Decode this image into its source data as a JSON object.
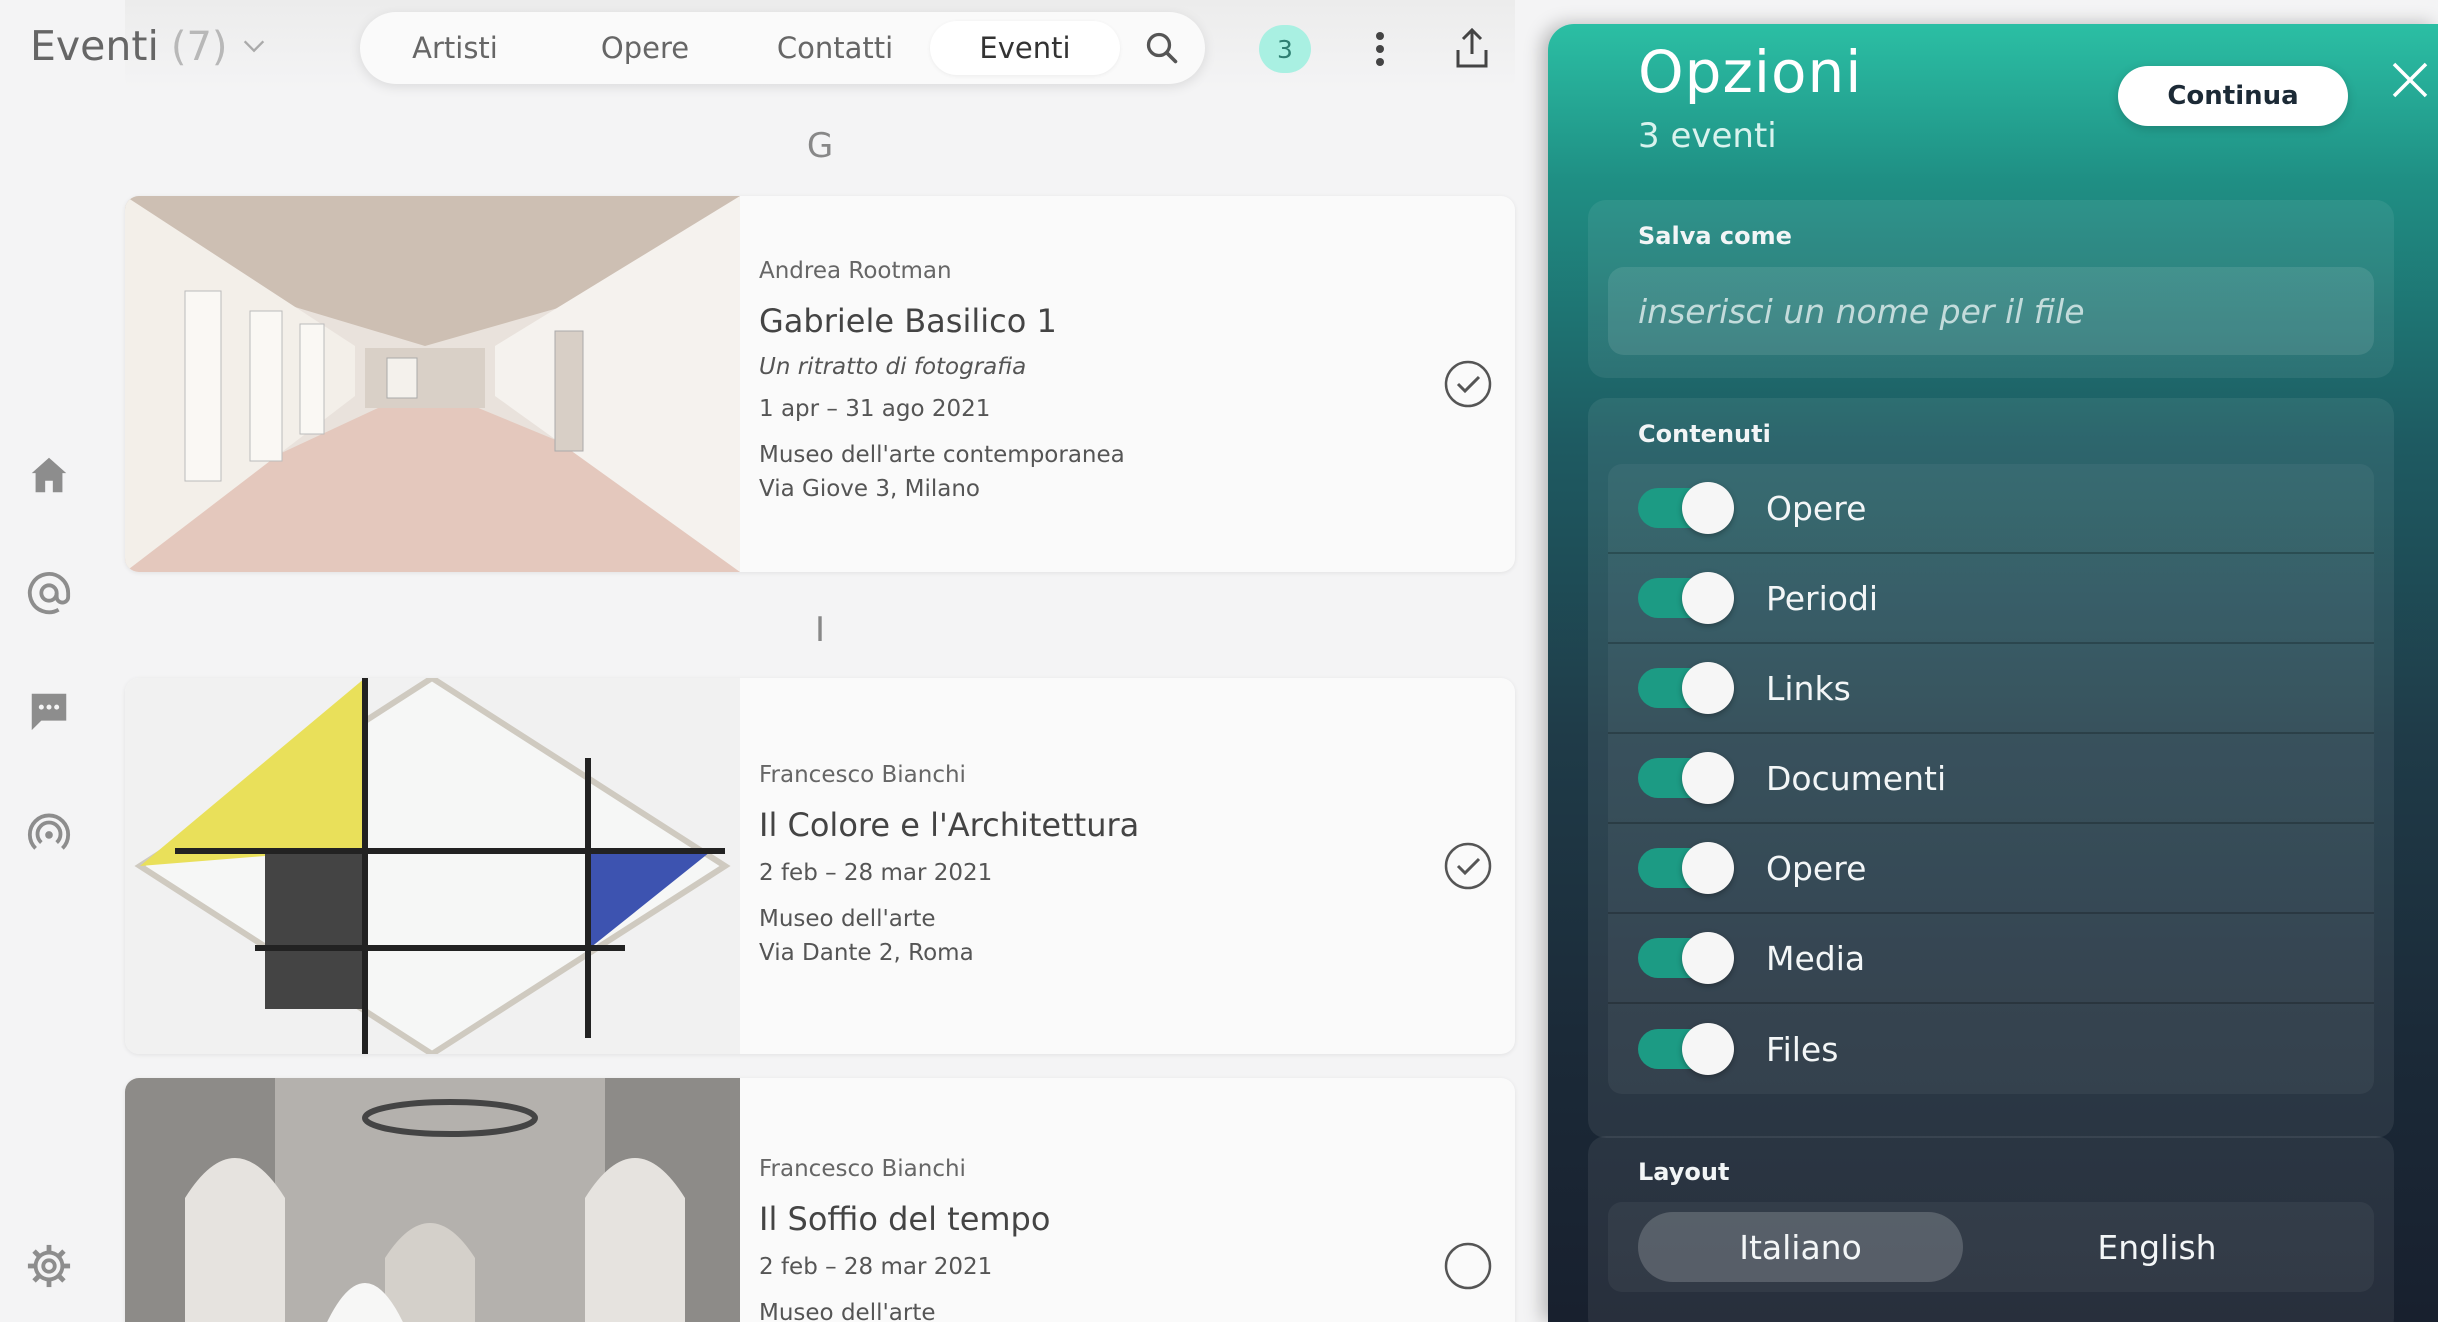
{
  "header": {
    "title": "Eventi",
    "count": "(7)",
    "nav": [
      {
        "label": "Artisti"
      },
      {
        "label": "Opere"
      },
      {
        "label": "Contatti"
      },
      {
        "label": "Eventi"
      }
    ],
    "active_nav": "Eventi",
    "selected_badge": "3"
  },
  "list": {
    "groups": [
      {
        "letter": "G"
      },
      {
        "letter": "I"
      }
    ],
    "events": [
      {
        "author": "Andrea Rootman",
        "title": "Gabriele Basilico 1",
        "subtitle": "Un ritratto di fotografia",
        "dates": "1 apr – 31 ago 2021",
        "venue": "Museo dell'arte contemporanea",
        "address": "Via Giove 3, Milano",
        "selected": true
      },
      {
        "author": "Francesco Bianchi",
        "title": "Il Colore e l'Architettura",
        "dates": "2 feb – 28 mar 2021",
        "venue": "Museo dell'arte",
        "address": "Via Dante 2, Roma",
        "selected": true
      },
      {
        "author": "Francesco Bianchi",
        "title": "Il Soffio del tempo",
        "dates": "2 feb – 28 mar 2021",
        "venue": "Museo dell'arte",
        "selected": false
      }
    ]
  },
  "options": {
    "title": "Opzioni",
    "subtitle": "3 eventi",
    "continue_label": "Continua",
    "save_as": {
      "label": "Salva come",
      "placeholder": "inserisci un nome per il file",
      "value": ""
    },
    "contents": {
      "label": "Contenuti",
      "items": [
        {
          "label": "Opere",
          "on": true
        },
        {
          "label": "Periodi",
          "on": true
        },
        {
          "label": "Links",
          "on": true
        },
        {
          "label": "Documenti",
          "on": true
        },
        {
          "label": "Opere",
          "on": true
        },
        {
          "label": "Media",
          "on": true
        },
        {
          "label": "Files",
          "on": true
        }
      ]
    },
    "layout": {
      "label": "Layout",
      "options": [
        "Italiano",
        "English"
      ],
      "selected": "Italiano"
    }
  },
  "colors": {
    "accent": "#2bbfa4",
    "toggle_on": "#1c9b84",
    "badge_bg": "#a9f0e2",
    "panel_dark": "#18202e"
  },
  "icons": {
    "rail": [
      "home-icon",
      "at-icon",
      "chat-icon",
      "broadcast-icon",
      "settings-icon"
    ],
    "header": [
      "chevron-down-icon",
      "search-icon",
      "more-vertical-icon",
      "share-icon"
    ],
    "panel": [
      "close-icon"
    ]
  }
}
